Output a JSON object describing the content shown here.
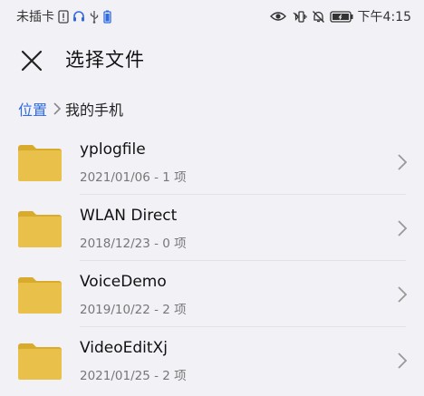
{
  "status_bar": {
    "carrier": "未插卡",
    "time": "下午4:15",
    "icons_left": [
      "sim-alert-icon",
      "headset-icon",
      "usb-icon",
      "battery-saver-icon"
    ],
    "icons_right": [
      "eye-icon",
      "vibrate-icon",
      "mute-icon",
      "battery-icon"
    ]
  },
  "header": {
    "title": "选择文件",
    "close_icon": "close-icon"
  },
  "breadcrumb": {
    "root": "位置",
    "current": "我的手机"
  },
  "files": [
    {
      "name": "yplogfile",
      "meta": "2021/01/06 - 1 项"
    },
    {
      "name": "WLAN Direct",
      "meta": "2018/12/23 - 0 项"
    },
    {
      "name": "VoiceDemo",
      "meta": "2019/10/22 - 2 项"
    },
    {
      "name": "VideoEditXj",
      "meta": "2021/01/25 - 2 项"
    }
  ],
  "colors": {
    "background": "#f2f1f6",
    "folder": "#e8c04a",
    "folder_tab": "#d9ab2c",
    "link": "#2f6ae0"
  }
}
